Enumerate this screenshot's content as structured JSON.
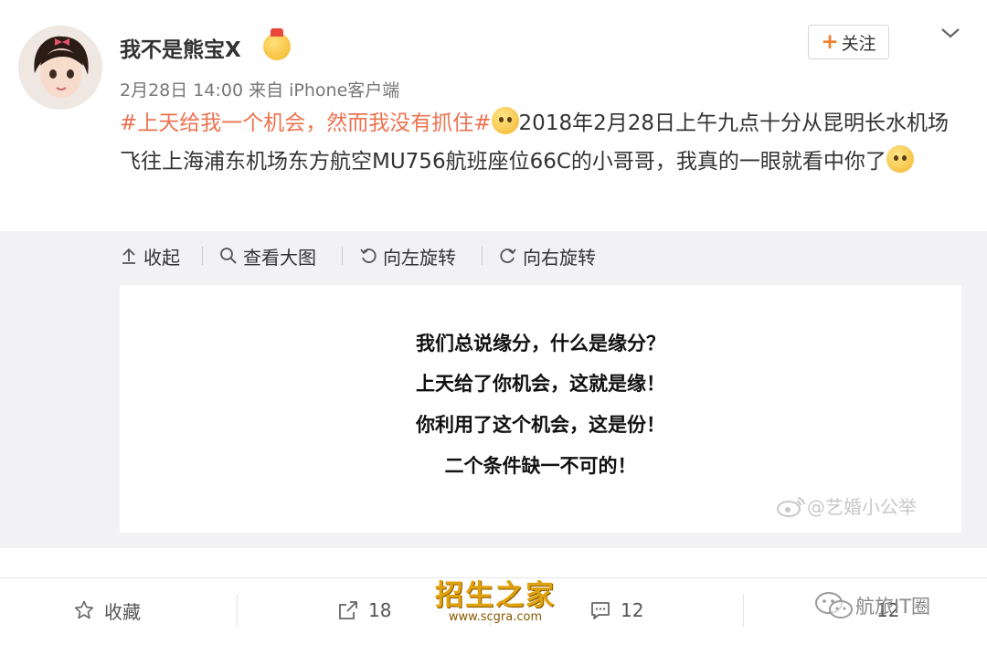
{
  "header": {
    "username": "我不是熊宝X",
    "meta": "2月28日 14:00 来自 iPhone客户端",
    "follow_label": "关注"
  },
  "post": {
    "topic": "#上天给我一个机会，然而我没有抓住#",
    "body": "2018年2月28日上午九点十分从昆明长水机场飞往上海浦东机场东方航空MU756航班座位66C的小哥哥，我真的一眼就看中你了"
  },
  "toolbar": {
    "collapse": "收起",
    "view_large": "查看大图",
    "rotate_left": "向左旋转",
    "rotate_right": "向右旋转"
  },
  "image": {
    "lines": [
      "我们总说缘分，什么是缘分？",
      "上天给了你机会，这就是缘！",
      "你利用了这个机会，这是份！",
      "二个条件缺一不可的！"
    ],
    "watermark": "@艺婚小公举"
  },
  "actions": {
    "favorite": "收藏",
    "share_count": "18",
    "comment_count": "12",
    "like_count": "12"
  },
  "overlay": {
    "site_name": "招生之家",
    "site_url": "www.scgra.com",
    "wechat_account": "航旅IT圈"
  },
  "colors": {
    "topic": "#eb7350",
    "follow_plus": "#f27e2f",
    "panel_bg": "#f2f2f5"
  },
  "icons": [
    "avatar",
    "crown-emoji",
    "chevron-down-icon",
    "arrow-up-icon",
    "magnifier-icon",
    "rotate-left-icon",
    "rotate-right-icon",
    "star-icon",
    "share-icon",
    "comment-icon",
    "weibo-icon",
    "wechat-icon"
  ]
}
